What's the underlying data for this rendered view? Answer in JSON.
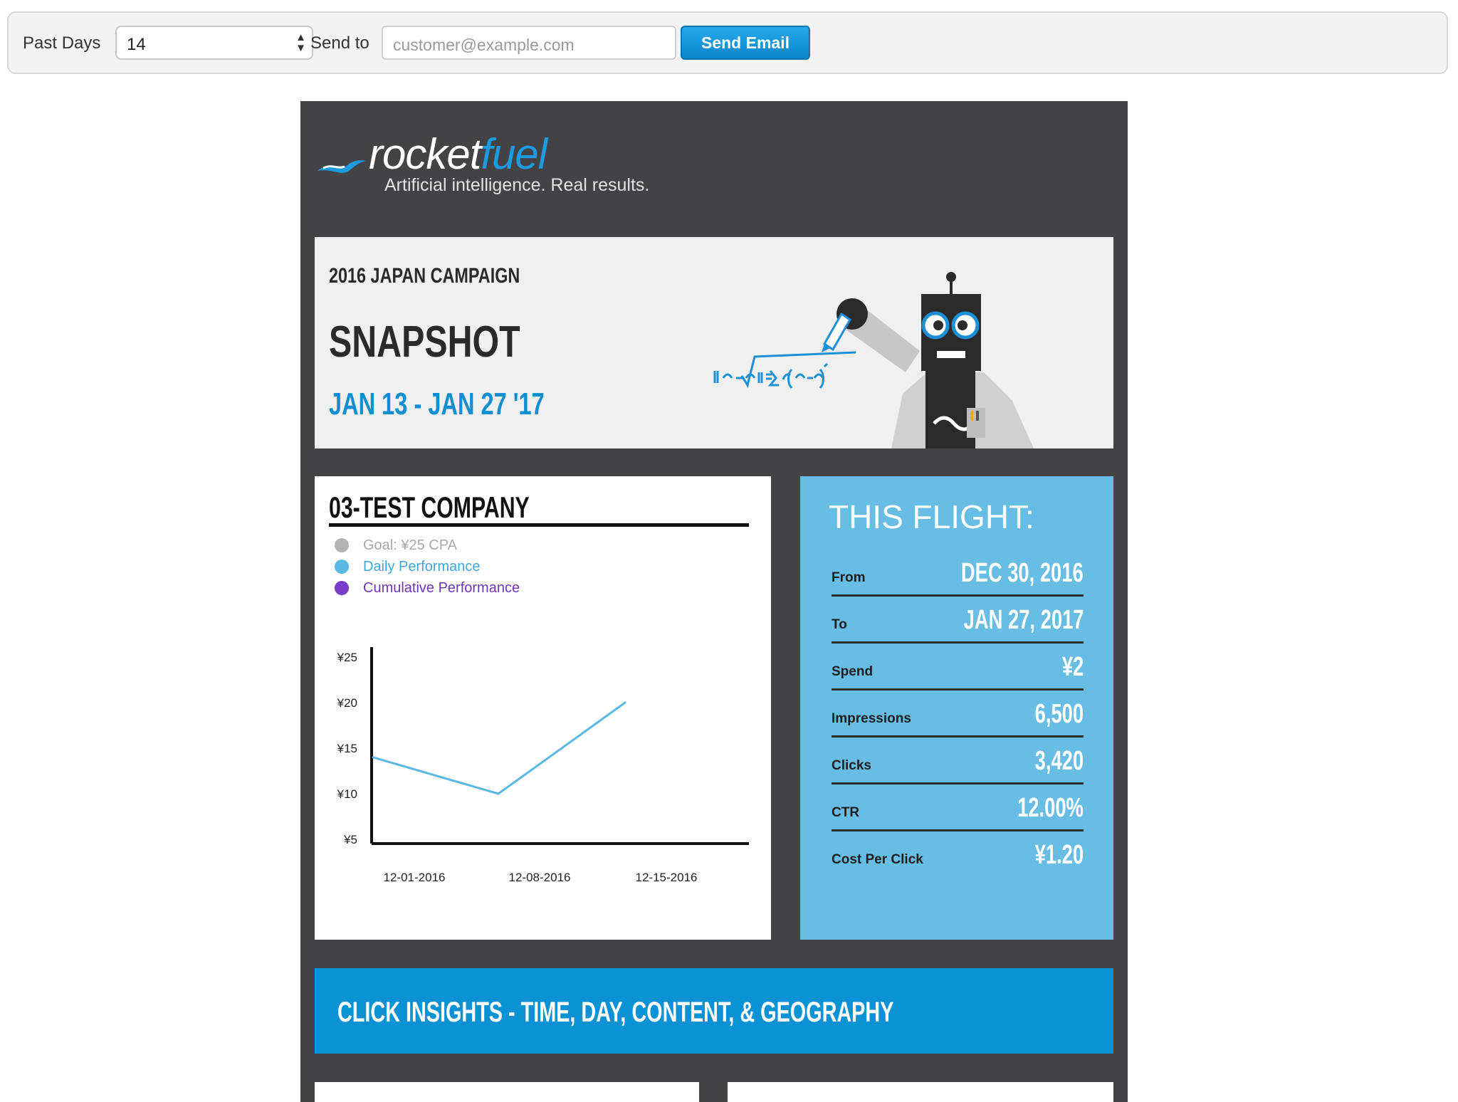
{
  "toolbar": {
    "past_days_label": "Past Days",
    "past_days_value": "14",
    "send_to_label": "Send to",
    "email_placeholder": "customer@example.com",
    "send_button": "Send Email"
  },
  "brand": {
    "logo_part1": "rocket",
    "logo_part2": "fuel",
    "tagline": "Artificial intelligence. Real results."
  },
  "hero": {
    "campaign": "2016 JAPAN CAMPAIGN",
    "title": "SNAPSHOT",
    "dates": "JAN 13 - JAN 27 '17"
  },
  "chart_card": {
    "company": "03-TEST COMPANY",
    "legend": [
      {
        "label": "Goal: ¥25 CPA",
        "color": "#b3b3b3"
      },
      {
        "label": "Daily Performance",
        "color": "#5ab8e3"
      },
      {
        "label": "Cumulative Performance",
        "color": "#7a3ec6"
      }
    ]
  },
  "chart_data": {
    "type": "line",
    "x": [
      "12-01-2016",
      "12-08-2016",
      "12-15-2016"
    ],
    "y_ticks": [
      "¥25",
      "¥20",
      "¥15",
      "¥10",
      "¥5"
    ],
    "ylim": [
      5,
      25
    ],
    "series": [
      {
        "name": "Daily Performance",
        "color": "#5ab8e3",
        "values": [
          14,
          10,
          20
        ]
      }
    ]
  },
  "flight": {
    "title": "THIS FLIGHT:",
    "rows": [
      {
        "label": "From",
        "value": "DEC 30, 2016"
      },
      {
        "label": "To",
        "value": "JAN 27, 2017"
      },
      {
        "label": "Spend",
        "value": "¥2"
      },
      {
        "label": "Impressions",
        "value": "6,500"
      },
      {
        "label": "Clicks",
        "value": "3,420"
      },
      {
        "label": "CTR",
        "value": "12.00%"
      },
      {
        "label": "Cost Per Click",
        "value": "¥1.20"
      }
    ]
  },
  "insights": {
    "title": "CLICK INSIGHTS - TIME, DAY, CONTENT, & GEOGRAPHY"
  },
  "colors": {
    "panel": "#434345",
    "accent_blue": "#0a92d4",
    "flight_blue": "#67bde4"
  }
}
